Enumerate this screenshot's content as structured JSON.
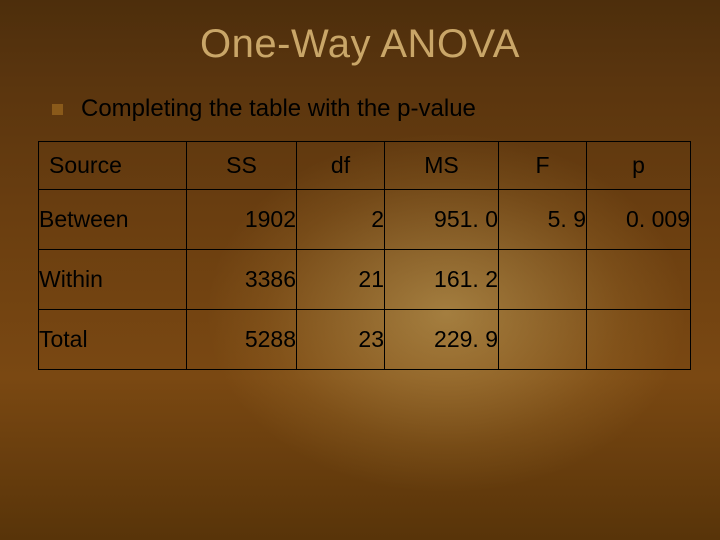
{
  "title": "One-Way ANOVA",
  "bullet": "Completing the table with the p-value",
  "table": {
    "headers": {
      "source": "Source",
      "ss": "SS",
      "df": "df",
      "ms": "MS",
      "f": "F",
      "p": "p"
    },
    "rows": [
      {
        "source": "Between",
        "ss": "1902",
        "df": "2",
        "ms": "951. 0",
        "f": "5. 9",
        "p": "0. 009"
      },
      {
        "source": "Within",
        "ss": "3386",
        "df": "21",
        "ms": "161. 2",
        "f": "",
        "p": ""
      },
      {
        "source": "Total",
        "ss": "5288",
        "df": "23",
        "ms": "229. 9",
        "f": "",
        "p": ""
      }
    ]
  },
  "chart_data": {
    "type": "table",
    "title": "One-Way ANOVA",
    "columns": [
      "Source",
      "SS",
      "df",
      "MS",
      "F",
      "p"
    ],
    "rows": [
      [
        "Between",
        1902,
        2,
        951.0,
        5.9,
        0.009
      ],
      [
        "Within",
        3386,
        21,
        161.2,
        null,
        null
      ],
      [
        "Total",
        5288,
        23,
        229.9,
        null,
        null
      ]
    ]
  }
}
